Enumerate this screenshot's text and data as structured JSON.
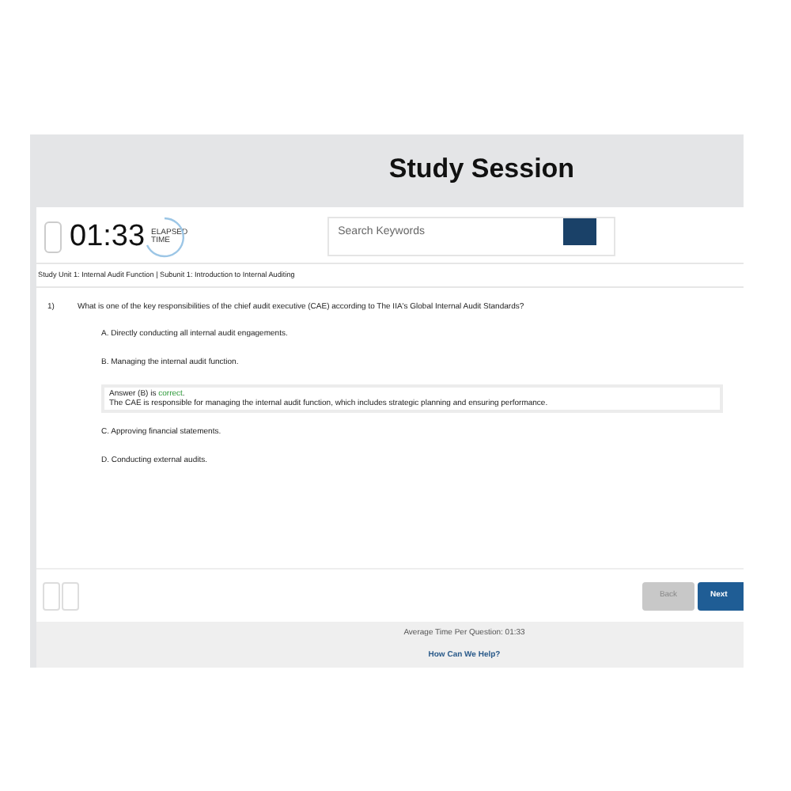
{
  "header": {
    "title": "Study Session"
  },
  "timer": {
    "time": "01:33",
    "label_top": "ELAPSED",
    "label_bottom": "TIME"
  },
  "search": {
    "placeholder": "Search Keywords"
  },
  "breadcrumb": "Study Unit 1: Internal Audit Function | Subunit 1: Introduction to Internal Auditing",
  "question": {
    "number": "1)",
    "text": "What is one of the key responsibilities of the chief audit executive (CAE) according to The IIA's Global Internal Audit Standards?"
  },
  "options": [
    {
      "text": "A. Directly conducting all internal audit engagements."
    },
    {
      "text": "B. Managing the internal audit function.",
      "feedback": {
        "lead": "Answer (B) is ",
        "verdict": "correct",
        "trail": ".",
        "correct": true,
        "explanation": "The CAE is responsible for managing the internal audit function, which includes strategic planning and ensuring performance."
      }
    },
    {
      "text": "C. Approving financial statements."
    },
    {
      "text": "D. Conducting external audits."
    }
  ],
  "nav": {
    "back": {
      "label": "Back",
      "disabled": true
    },
    "next": {
      "label": "Next",
      "disabled": false
    }
  },
  "footer": {
    "average": "Average Time Per Question: 01:33",
    "help": "How Can We Help?"
  }
}
